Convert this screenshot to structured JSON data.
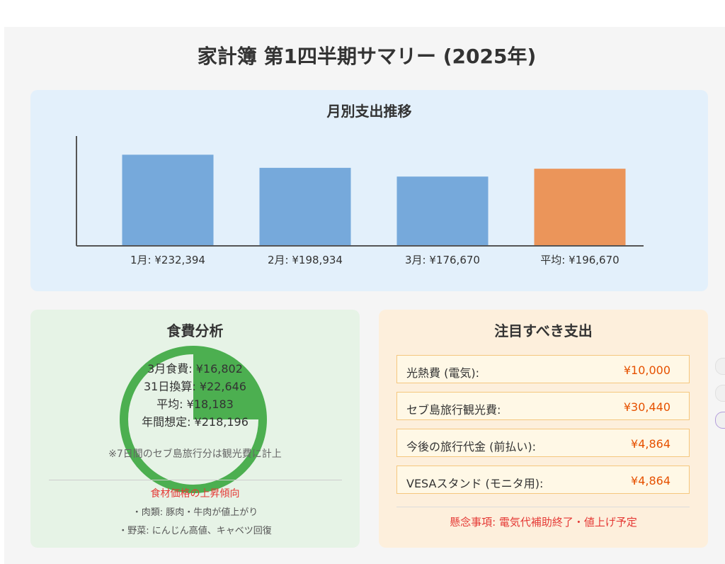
{
  "title": "家計簿 第1四半期サマリー (2025年)",
  "trend": {
    "title": "月別支出推移"
  },
  "food": {
    "title": "食費分析",
    "stats": [
      "3月食費: ¥16,802",
      "31日換算: ¥22,646",
      "平均: ¥18,183",
      "年間想定: ¥218,196"
    ],
    "note": "※7日間のセブ島旅行分は観光費に計上",
    "alert": "食材価格の上昇傾向",
    "bullets": [
      "・肉類: 豚肉・牛肉が値上がり",
      "・野菜: にんじん高値、キャベツ回復"
    ],
    "pie_fraction": 0.25,
    "colors": {
      "ring": "#4caf50"
    }
  },
  "notable": {
    "title": "注目すべき支出",
    "items": [
      {
        "label": "光熱費 (電気):",
        "amount": "¥10,000"
      },
      {
        "label": "セブ島旅行観光費:",
        "amount": "¥30,440"
      },
      {
        "label": "今後の旅行代金 (前払い):",
        "amount": "¥4,864"
      },
      {
        "label": "VESAスタンド (モニタ用):",
        "amount": "¥4,864"
      }
    ],
    "alert": "懸念事項: 電気代補助終了・値上げ予定"
  },
  "chart_data": {
    "type": "bar",
    "title": "月別支出推移",
    "categories": [
      "1月",
      "2月",
      "3月",
      "平均"
    ],
    "values": [
      232394,
      198934,
      176670,
      196670
    ],
    "labels": [
      "1月: ¥232,394",
      "2月: ¥198,934",
      "3月: ¥176,670",
      "平均: ¥196,670"
    ],
    "colors": [
      "#76a9db",
      "#76a9db",
      "#76a9db",
      "#eb955a"
    ],
    "ylim": [
      0,
      280000
    ],
    "grid": false,
    "legend": "none"
  }
}
